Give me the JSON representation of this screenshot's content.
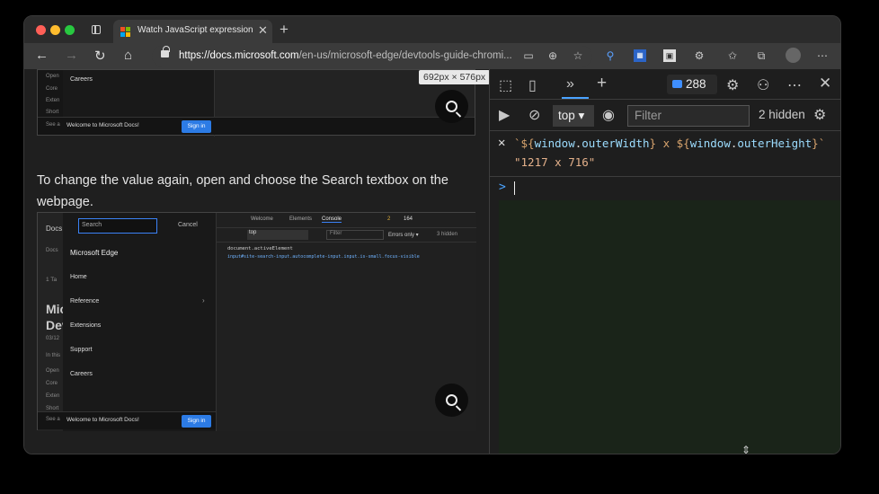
{
  "browser": {
    "tab_title": "Watch JavaScript expression v",
    "tab_close": "✕",
    "new_tab": "+",
    "url_host": "https://docs.microsoft.com",
    "url_path": "/en-us/microsoft-edge/devtools-guide-chromi..."
  },
  "page": {
    "paragraph": "To change the value again, open and choose the Search textbox on the webpage.",
    "dimension_tooltip": "692px × 576px",
    "shot1": {
      "careers": "Careers",
      "sidebar_items": [
        "Open",
        "Core",
        "Exten",
        "Short",
        "See a"
      ],
      "welcome": "Welcome to Microsoft Docs!",
      "sign_in": "Sign in"
    },
    "shot2": {
      "search_placeholder": "Search",
      "cancel": "Cancel",
      "menu_title": "Microsoft Edge",
      "menu_items": [
        "Home",
        "Reference",
        "Extensions",
        "Support",
        "Careers"
      ],
      "page_text": [
        "Docs",
        "1 Ta",
        "Mic",
        "Dev",
        "03/12",
        "In this",
        "Open",
        "Core",
        "Exten",
        "Short",
        "See a"
      ],
      "welcome": "Welcome to Microsoft Docs!",
      "sign_in": "Sign in",
      "dt_tabs": [
        "Welcome",
        "Elements",
        "Console"
      ],
      "dt_warn": "2",
      "dt_info": "164",
      "dt_context": "top",
      "dt_filter": "Filter",
      "dt_levels": "Errors only ▾",
      "dt_hidden": "3 hidden",
      "dt_line1": "document.activeElement",
      "dt_line2": "input#site-search-input.autocomplete-input.input.is-small.focus-visible"
    }
  },
  "devtools": {
    "issues_count": "288",
    "context": "top",
    "filter_placeholder": "Filter",
    "hidden_label": "2 hidden",
    "expression": {
      "t1": "`${",
      "v1": "window",
      "t2": ".",
      "v2": "outerWidth",
      "t3": "} x ${",
      "v3": "window",
      "t4": ".",
      "v4": "outerHeight",
      "t5": "}`"
    },
    "result": "\"1217 x 716\""
  }
}
